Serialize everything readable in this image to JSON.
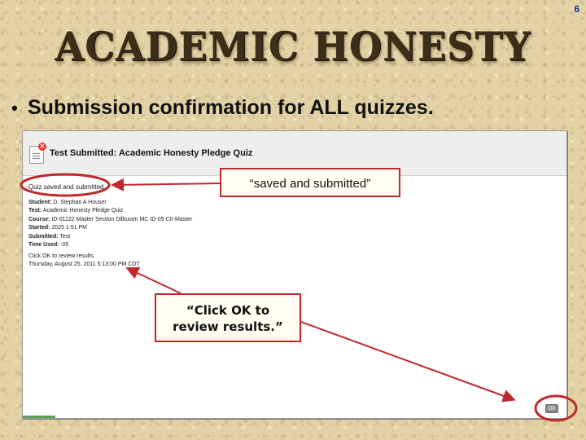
{
  "slide": {
    "number": "6",
    "title": "ACADEMIC HONESTY",
    "bullet": "Submission confirmation for ALL quizzes."
  },
  "screenshot": {
    "page_title": "Test Submitted: Academic Honesty Pledge Quiz",
    "status_text": "Quiz saved and submitted.",
    "details": [
      {
        "key": "Student:",
        "value": "D. Stephan A Houser"
      },
      {
        "key": "Test:",
        "value": "Academic Honesty Pledge Quiz"
      },
      {
        "key": "Course:",
        "value": "ID-01122 Master Section Dilbusen MC ID-05-CII-Master"
      },
      {
        "key": "Started:",
        "value": "2025 1:51 PM"
      },
      {
        "key": "Submitted:",
        "value": "Test"
      },
      {
        "key": "Time Used:",
        "value": ":05"
      }
    ],
    "ok_message_line1": "Click OK to review results.",
    "ok_message_line2": "Thursday, August 25, 2011 5:13:00 PM CDT",
    "ok_button_label": "OK"
  },
  "callouts": {
    "saved_submitted": "“saved and submitted”",
    "click_ok_line1": "“Click OK to",
    "click_ok_line2": "review results.”"
  },
  "colors": {
    "accent_red": "#c0282a",
    "title_brown": "#3d2e1a",
    "slide_number_blue": "#1f2f9a"
  }
}
